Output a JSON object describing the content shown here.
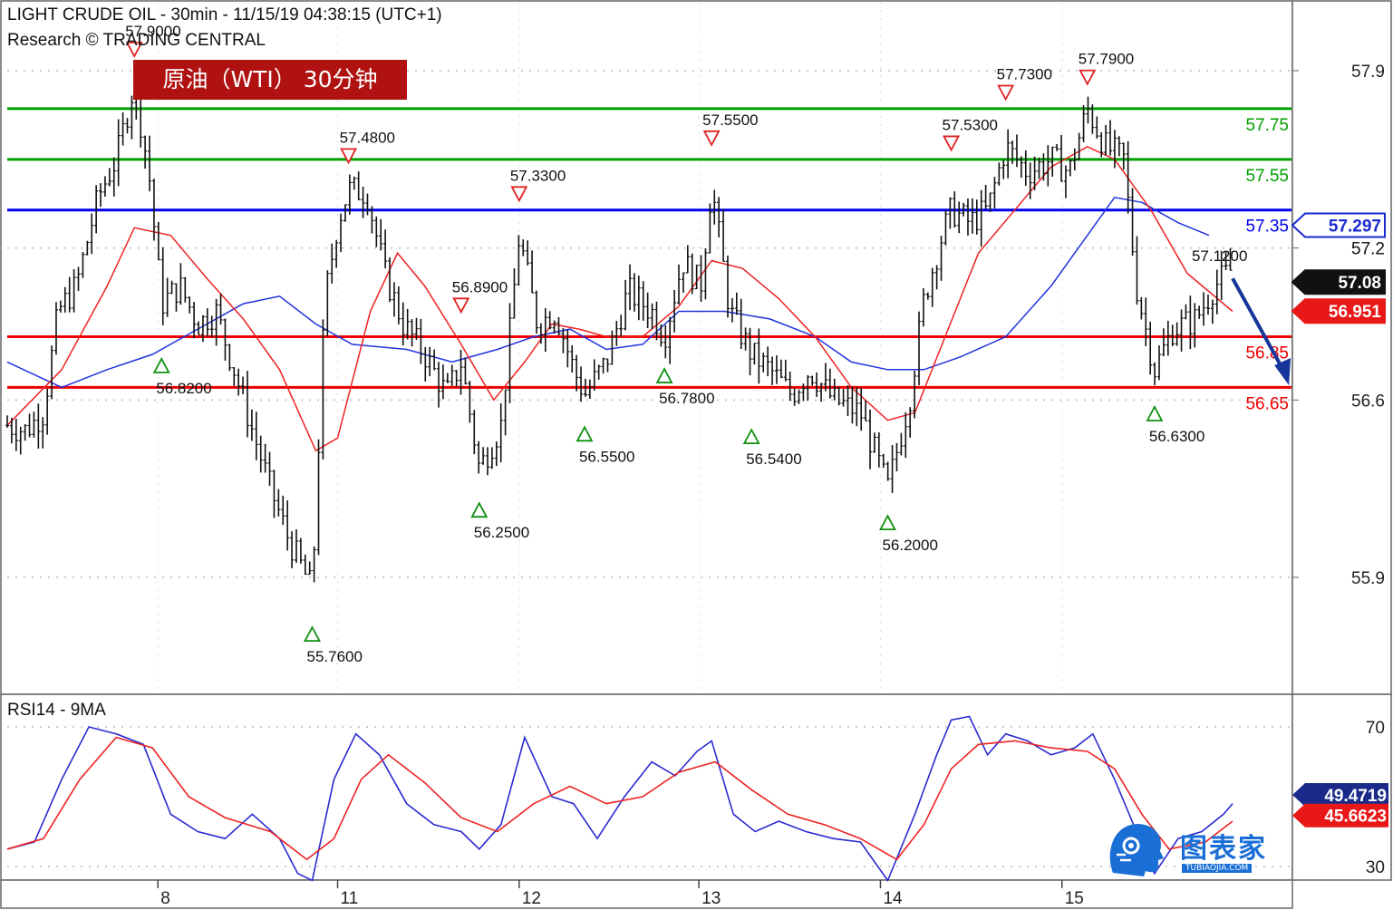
{
  "header": {
    "title": "LIGHT CRUDE OIL - 30min - 11/15/19 04:38:15 (UTC+1)",
    "source": "Research © TRADING CENTRAL"
  },
  "badge": {
    "text": "原油（WTI） 30分钟"
  },
  "logo": {
    "name": "图表家",
    "sub": "TUBIAOJIA.COM",
    "icon": "robot-head-icon"
  },
  "colors": {
    "resistance": "#00a000",
    "pivot": "#0000ee",
    "support": "#ee0000",
    "price": "#111111",
    "ma_fast": "#ee2222",
    "ma_slow": "#2233dd",
    "arrow": "#16359a",
    "badge": "#b01212"
  },
  "chart_data": {
    "type": "line",
    "title": "LIGHT CRUDE OIL - 30min - 11/15/19 04:38:15 (UTC+1)",
    "x_ticks": [
      "8",
      "11",
      "12",
      "13",
      "14",
      "15"
    ],
    "y_ticks": [
      "57.9",
      "57.2",
      "56.6",
      "55.9"
    ],
    "ylim": [
      55.55,
      58.1
    ],
    "levels": [
      {
        "label": "57.75",
        "value": 57.75,
        "kind": "resistance"
      },
      {
        "label": "57.55",
        "value": 57.55,
        "kind": "resistance"
      },
      {
        "label": "57.35",
        "value": 57.35,
        "kind": "pivot"
      },
      {
        "label": "56.85",
        "value": 56.85,
        "kind": "support"
      },
      {
        "label": "56.65",
        "value": 56.65,
        "kind": "support"
      }
    ],
    "price_tags": [
      {
        "label": "57.297",
        "value": 57.297,
        "style": "blue"
      },
      {
        "label": "57.2",
        "value": 57.2,
        "style": "grey"
      },
      {
        "label": "57.08",
        "value": 57.08,
        "style": "black"
      },
      {
        "label": "56.951",
        "value": 56.951,
        "style": "red"
      }
    ],
    "swings": [
      {
        "t": 0.7,
        "value": 57.9,
        "label": "57.9000",
        "type": "high"
      },
      {
        "t": 0.85,
        "value": 56.82,
        "label": "56.8200",
        "type": "low"
      },
      {
        "t": 1.68,
        "value": 55.76,
        "label": "55.7600",
        "type": "low"
      },
      {
        "t": 1.88,
        "value": 57.48,
        "label": "57.4800",
        "type": "high"
      },
      {
        "t": 2.5,
        "value": 56.89,
        "label": "56.8900",
        "type": "high"
      },
      {
        "t": 2.6,
        "value": 56.25,
        "label": "56.2500",
        "type": "low"
      },
      {
        "t": 2.82,
        "value": 57.33,
        "label": "57.3300",
        "type": "high"
      },
      {
        "t": 3.18,
        "value": 56.55,
        "label": "56.5500",
        "type": "low"
      },
      {
        "t": 3.62,
        "value": 56.78,
        "label": "56.7800",
        "type": "low"
      },
      {
        "t": 3.88,
        "value": 57.55,
        "label": "57.5500",
        "type": "high"
      },
      {
        "t": 4.1,
        "value": 56.54,
        "label": "56.5400",
        "type": "low"
      },
      {
        "t": 4.85,
        "value": 56.2,
        "label": "56.2000",
        "type": "low"
      },
      {
        "t": 5.2,
        "value": 57.53,
        "label": "57.5300",
        "type": "high"
      },
      {
        "t": 5.5,
        "value": 57.73,
        "label": "57.7300",
        "type": "high"
      },
      {
        "t": 5.95,
        "value": 57.79,
        "label": "57.7900",
        "type": "high"
      },
      {
        "t": 6.32,
        "value": 56.63,
        "label": "56.6300",
        "type": "low"
      }
    ],
    "annotations": [
      {
        "t": 6.6,
        "value": 57.12,
        "label": "57.1200"
      }
    ],
    "price_path": [
      [
        0.0,
        56.5
      ],
      [
        0.1,
        56.48
      ],
      [
        0.2,
        56.55
      ],
      [
        0.28,
        56.95
      ],
      [
        0.38,
        57.05
      ],
      [
        0.5,
        57.4
      ],
      [
        0.6,
        57.55
      ],
      [
        0.7,
        57.85
      ],
      [
        0.78,
        57.5
      ],
      [
        0.85,
        56.98
      ],
      [
        0.95,
        57.05
      ],
      [
        1.05,
        56.9
      ],
      [
        1.15,
        56.95
      ],
      [
        1.25,
        56.72
      ],
      [
        1.35,
        56.48
      ],
      [
        1.45,
        56.25
      ],
      [
        1.55,
        56.05
      ],
      [
        1.68,
        55.85
      ],
      [
        1.75,
        57.0
      ],
      [
        1.82,
        57.3
      ],
      [
        1.88,
        57.43
      ],
      [
        1.98,
        57.42
      ],
      [
        2.08,
        57.1
      ],
      [
        2.18,
        56.9
      ],
      [
        2.3,
        56.78
      ],
      [
        2.42,
        56.62
      ],
      [
        2.5,
        56.75
      ],
      [
        2.6,
        56.33
      ],
      [
        2.72,
        56.5
      ],
      [
        2.82,
        57.25
      ],
      [
        2.92,
        56.9
      ],
      [
        3.02,
        56.95
      ],
      [
        3.12,
        56.72
      ],
      [
        3.18,
        56.62
      ],
      [
        3.3,
        56.75
      ],
      [
        3.42,
        57.03
      ],
      [
        3.55,
        56.95
      ],
      [
        3.62,
        56.85
      ],
      [
        3.72,
        57.15
      ],
      [
        3.82,
        57.05
      ],
      [
        3.88,
        57.45
      ],
      [
        3.98,
        56.95
      ],
      [
        4.1,
        56.78
      ],
      [
        4.2,
        56.72
      ],
      [
        4.32,
        56.62
      ],
      [
        4.42,
        56.72
      ],
      [
        4.55,
        56.6
      ],
      [
        4.7,
        56.55
      ],
      [
        4.85,
        56.25
      ],
      [
        4.97,
        56.6
      ],
      [
        5.05,
        57.0
      ],
      [
        5.15,
        57.25
      ],
      [
        5.2,
        57.35
      ],
      [
        5.3,
        57.3
      ],
      [
        5.4,
        57.35
      ],
      [
        5.5,
        57.6
      ],
      [
        5.62,
        57.5
      ],
      [
        5.75,
        57.55
      ],
      [
        5.85,
        57.5
      ],
      [
        5.95,
        57.75
      ],
      [
        6.05,
        57.6
      ],
      [
        6.15,
        57.55
      ],
      [
        6.22,
        57.05
      ],
      [
        6.32,
        56.72
      ],
      [
        6.42,
        56.88
      ],
      [
        6.55,
        56.92
      ],
      [
        6.65,
        57.05
      ],
      [
        6.75,
        57.12
      ]
    ],
    "ma_fast_path": [
      [
        0.0,
        56.5
      ],
      [
        0.3,
        56.72
      ],
      [
        0.55,
        57.05
      ],
      [
        0.7,
        57.28
      ],
      [
        0.9,
        57.25
      ],
      [
        1.1,
        57.08
      ],
      [
        1.3,
        56.92
      ],
      [
        1.5,
        56.72
      ],
      [
        1.7,
        56.4
      ],
      [
        1.82,
        56.45
      ],
      [
        2.0,
        56.95
      ],
      [
        2.15,
        57.18
      ],
      [
        2.3,
        57.05
      ],
      [
        2.5,
        56.82
      ],
      [
        2.68,
        56.6
      ],
      [
        2.85,
        56.75
      ],
      [
        3.0,
        56.9
      ],
      [
        3.15,
        56.88
      ],
      [
        3.3,
        56.85
      ],
      [
        3.5,
        56.85
      ],
      [
        3.7,
        56.97
      ],
      [
        3.88,
        57.15
      ],
      [
        4.05,
        57.12
      ],
      [
        4.25,
        57.0
      ],
      [
        4.45,
        56.85
      ],
      [
        4.65,
        56.65
      ],
      [
        4.85,
        56.52
      ],
      [
        5.0,
        56.55
      ],
      [
        5.15,
        56.82
      ],
      [
        5.35,
        57.18
      ],
      [
        5.55,
        57.35
      ],
      [
        5.75,
        57.52
      ],
      [
        5.95,
        57.6
      ],
      [
        6.1,
        57.55
      ],
      [
        6.3,
        57.35
      ],
      [
        6.5,
        57.1
      ],
      [
        6.75,
        56.95
      ]
    ],
    "ma_slow_path": [
      [
        0.0,
        56.75
      ],
      [
        0.3,
        56.65
      ],
      [
        0.55,
        56.72
      ],
      [
        0.8,
        56.78
      ],
      [
        1.1,
        56.9
      ],
      [
        1.3,
        56.98
      ],
      [
        1.5,
        57.01
      ],
      [
        1.7,
        56.9
      ],
      [
        1.9,
        56.82
      ],
      [
        2.2,
        56.8
      ],
      [
        2.45,
        56.75
      ],
      [
        2.7,
        56.8
      ],
      [
        2.9,
        56.85
      ],
      [
        3.1,
        56.88
      ],
      [
        3.3,
        56.8
      ],
      [
        3.5,
        56.82
      ],
      [
        3.7,
        56.95
      ],
      [
        3.95,
        56.95
      ],
      [
        4.2,
        56.92
      ],
      [
        4.45,
        56.85
      ],
      [
        4.65,
        56.75
      ],
      [
        4.85,
        56.72
      ],
      [
        5.05,
        56.72
      ],
      [
        5.25,
        56.77
      ],
      [
        5.5,
        56.85
      ],
      [
        5.75,
        57.05
      ],
      [
        5.95,
        57.25
      ],
      [
        6.1,
        57.4
      ],
      [
        6.25,
        57.38
      ],
      [
        6.45,
        57.3
      ],
      [
        6.62,
        57.25
      ]
    ],
    "forecast_arrow": [
      [
        6.75,
        57.08
      ],
      [
        7.05,
        56.68
      ]
    ],
    "rsi": {
      "title": "RSI14 - 9MA",
      "y_ticks": [
        "70",
        "30"
      ],
      "ylim": [
        20,
        80
      ],
      "rsi_path": [
        [
          0.0,
          35
        ],
        [
          0.15,
          37
        ],
        [
          0.3,
          55
        ],
        [
          0.45,
          70
        ],
        [
          0.6,
          68
        ],
        [
          0.75,
          65
        ],
        [
          0.9,
          45
        ],
        [
          1.05,
          40
        ],
        [
          1.2,
          38
        ],
        [
          1.35,
          45
        ],
        [
          1.5,
          38
        ],
        [
          1.6,
          28
        ],
        [
          1.68,
          26
        ],
        [
          1.8,
          55
        ],
        [
          1.92,
          68
        ],
        [
          2.05,
          62
        ],
        [
          2.2,
          48
        ],
        [
          2.35,
          42
        ],
        [
          2.5,
          40
        ],
        [
          2.6,
          35
        ],
        [
          2.72,
          42
        ],
        [
          2.85,
          67
        ],
        [
          3.0,
          50
        ],
        [
          3.12,
          48
        ],
        [
          3.25,
          38
        ],
        [
          3.4,
          50
        ],
        [
          3.55,
          60
        ],
        [
          3.68,
          56
        ],
        [
          3.8,
          63
        ],
        [
          3.88,
          66
        ],
        [
          4.0,
          45
        ],
        [
          4.12,
          40
        ],
        [
          4.25,
          43
        ],
        [
          4.4,
          40
        ],
        [
          4.55,
          38
        ],
        [
          4.7,
          37
        ],
        [
          4.85,
          26
        ],
        [
          5.0,
          45
        ],
        [
          5.12,
          62
        ],
        [
          5.2,
          72
        ],
        [
          5.3,
          73
        ],
        [
          5.4,
          62
        ],
        [
          5.5,
          68
        ],
        [
          5.62,
          66
        ],
        [
          5.75,
          62
        ],
        [
          5.88,
          64
        ],
        [
          5.98,
          68
        ],
        [
          6.1,
          55
        ],
        [
          6.22,
          40
        ],
        [
          6.32,
          28
        ],
        [
          6.45,
          38
        ],
        [
          6.58,
          40
        ],
        [
          6.7,
          45
        ],
        [
          6.75,
          48
        ]
      ],
      "ma_path": [
        [
          0.0,
          35
        ],
        [
          0.2,
          38
        ],
        [
          0.4,
          55
        ],
        [
          0.6,
          67
        ],
        [
          0.8,
          64
        ],
        [
          1.0,
          50
        ],
        [
          1.2,
          44
        ],
        [
          1.45,
          40
        ],
        [
          1.65,
          32
        ],
        [
          1.8,
          38
        ],
        [
          1.95,
          55
        ],
        [
          2.1,
          62
        ],
        [
          2.3,
          54
        ],
        [
          2.5,
          44
        ],
        [
          2.7,
          40
        ],
        [
          2.9,
          48
        ],
        [
          3.1,
          53
        ],
        [
          3.3,
          48
        ],
        [
          3.5,
          50
        ],
        [
          3.7,
          57
        ],
        [
          3.9,
          60
        ],
        [
          4.1,
          52
        ],
        [
          4.3,
          45
        ],
        [
          4.5,
          42
        ],
        [
          4.7,
          38
        ],
        [
          4.9,
          32
        ],
        [
          5.05,
          42
        ],
        [
          5.2,
          58
        ],
        [
          5.35,
          65
        ],
        [
          5.55,
          66
        ],
        [
          5.75,
          64
        ],
        [
          5.95,
          63
        ],
        [
          6.1,
          58
        ],
        [
          6.25,
          45
        ],
        [
          6.4,
          35
        ],
        [
          6.6,
          37
        ],
        [
          6.75,
          43
        ]
      ]
    }
  }
}
